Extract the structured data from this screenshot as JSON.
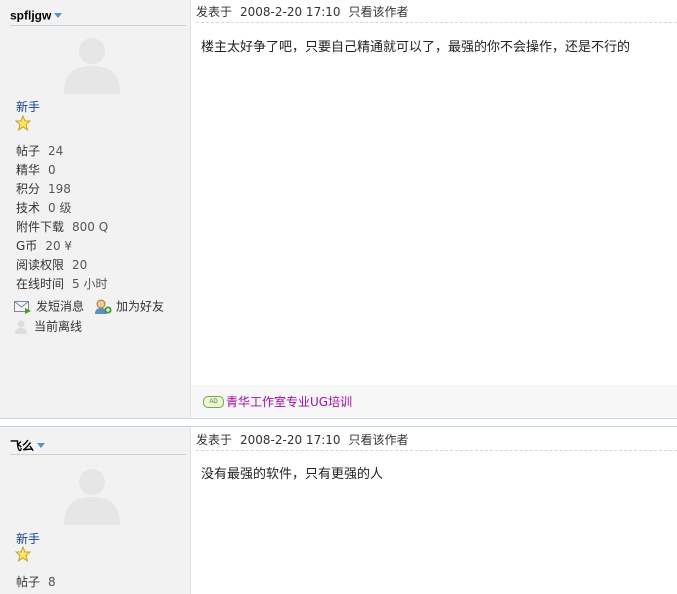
{
  "posts": [
    {
      "author": "spfljgw",
      "rank": "新手",
      "stats": [
        {
          "label": "帖子",
          "value": "24"
        },
        {
          "label": "精华",
          "value": "0"
        },
        {
          "label": "积分",
          "value": "198"
        },
        {
          "label": "技术",
          "value": "0 级"
        },
        {
          "label": "附件下载",
          "value": "800 Q"
        },
        {
          "label": "G币",
          "value": "20 ¥"
        },
        {
          "label": "阅读权限",
          "value": "20"
        },
        {
          "label": "在线时间",
          "value": "5 小时"
        }
      ],
      "actions": {
        "send_pm": "发短消息",
        "add_friend": "加为好友",
        "status": "当前离线"
      },
      "posted_label": "发表于",
      "posted_time": "2008-2-20 17:10",
      "only_author": "只看该作者",
      "message": "楼主太好争了吧，只要自己精通就可以了，最强的你不会操作，还是不行的",
      "ad": {
        "badge": "AD",
        "text": "青华工作室专业UG培训",
        "color": "#a40aa4"
      }
    },
    {
      "author": "飞么",
      "rank": "新手",
      "stats": [
        {
          "label": "帖子",
          "value": "8"
        }
      ],
      "posted_label": "发表于",
      "posted_time": "2008-2-20 17:10",
      "only_author": "只看该作者",
      "message": "没有最强的软件，只有更强的人"
    }
  ]
}
